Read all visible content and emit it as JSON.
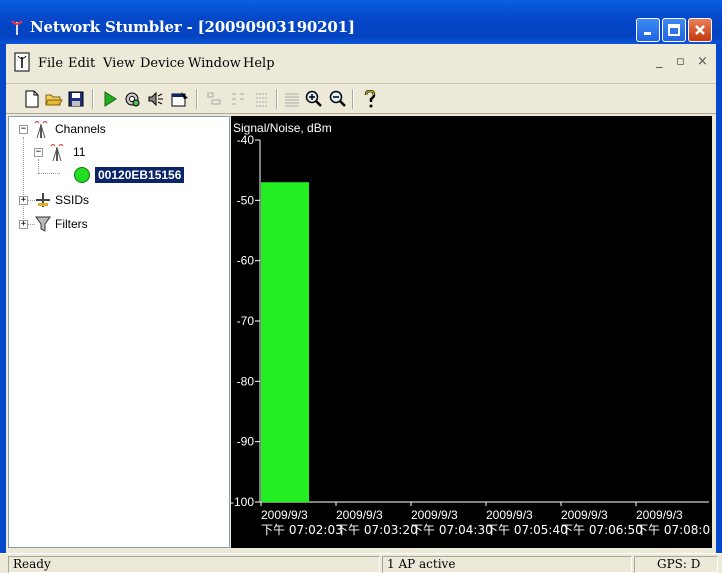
{
  "window": {
    "title": "Network Stumbler - [20090903190201]"
  },
  "menu": {
    "items": [
      "File",
      "Edit",
      "View",
      "Device",
      "Window",
      "Help"
    ],
    "mdi_controls": [
      "_",
      "▫",
      "×"
    ]
  },
  "toolbar": {
    "icons": [
      "new-icon",
      "open-icon",
      "save-icon",
      "play-icon",
      "auto-config-icon",
      "speaker-icon",
      "properties-icon",
      "list-icon-1",
      "list-icon-2",
      "list-icon-3",
      "grid-icon",
      "zoom-in-icon",
      "zoom-out-icon",
      "help-icon"
    ]
  },
  "tree": {
    "channels": "Channels",
    "channel_11": "11",
    "ap_mac": "00120EB15156",
    "ssids": "SSIDs",
    "filters": "Filters"
  },
  "chart_data": {
    "type": "bar",
    "ylabel": "Signal/Noise, dBm",
    "ylim": [
      -100,
      -40
    ],
    "yticks": [
      "-40",
      "-50",
      "-60",
      "-70",
      "-80",
      "-90",
      "-100"
    ],
    "x_dates": [
      "2009/9/3",
      "2009/9/3",
      "2009/9/3",
      "2009/9/3",
      "2009/9/3",
      "2009/9/3"
    ],
    "x_times": [
      "下午 07:02:03",
      "下午 07:03:20",
      "下午 07:04:30",
      "下午 07:05:40",
      "下午 07:06:50",
      "下午 07:08:0"
    ],
    "signal_values": [
      -47
    ],
    "bar_color": "#22ee22",
    "background": "#000000"
  },
  "status": {
    "left": "Ready",
    "middle": "1 AP active",
    "right": "GPS: D"
  }
}
